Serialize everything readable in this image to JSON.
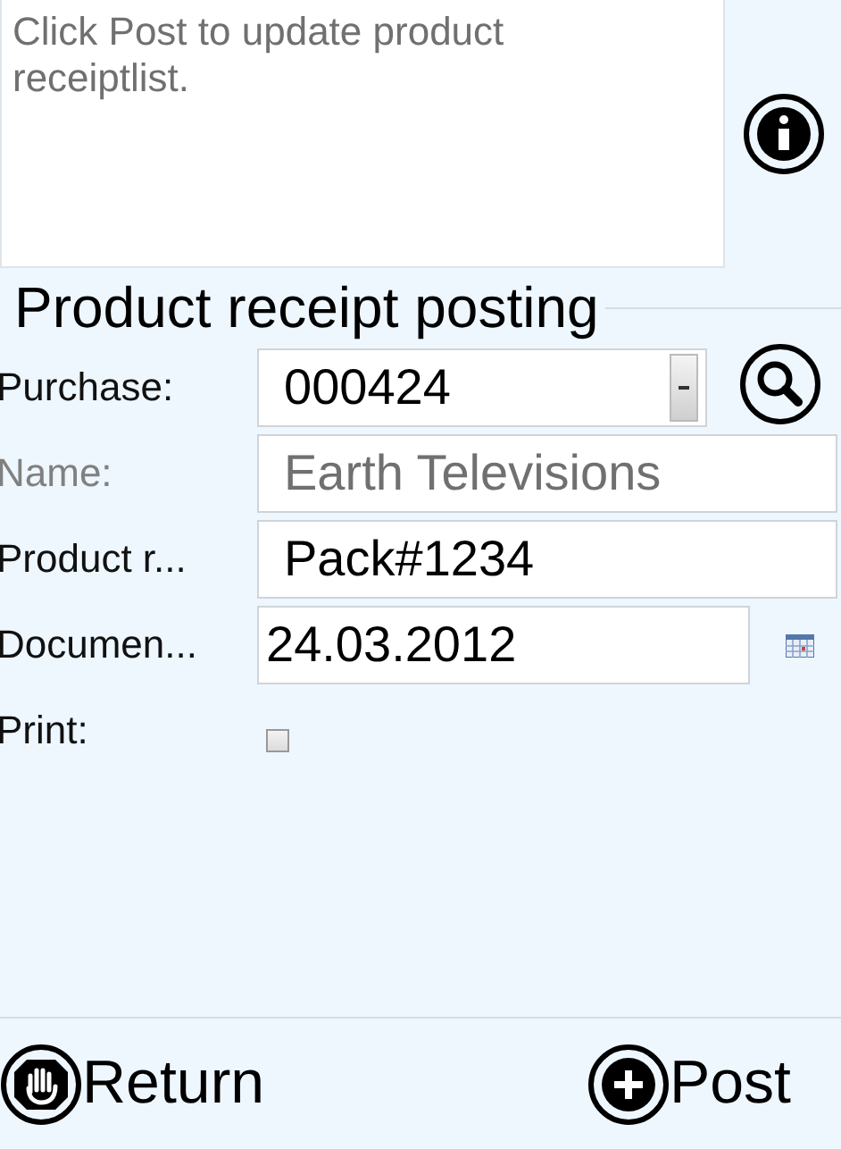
{
  "message": {
    "text": "Click Post to update product receiptlist."
  },
  "title": "Product receipt posting",
  "fields": [
    {
      "kind": "dropdown",
      "label": "Purchase:",
      "value": "000424"
    },
    {
      "kind": "text",
      "label": "Name:",
      "value": "Earth Televisions",
      "disabled": true
    },
    {
      "kind": "text",
      "label": "Product r...",
      "value": "Pack#1234"
    },
    {
      "kind": "date",
      "label": "Documen...",
      "value": "24.03.2012"
    },
    {
      "kind": "checkbox",
      "label": "Print:",
      "checked": false
    }
  ],
  "buttons": [
    {
      "kind": "return",
      "label": "Return"
    },
    {
      "kind": "post",
      "label": "Post"
    }
  ]
}
